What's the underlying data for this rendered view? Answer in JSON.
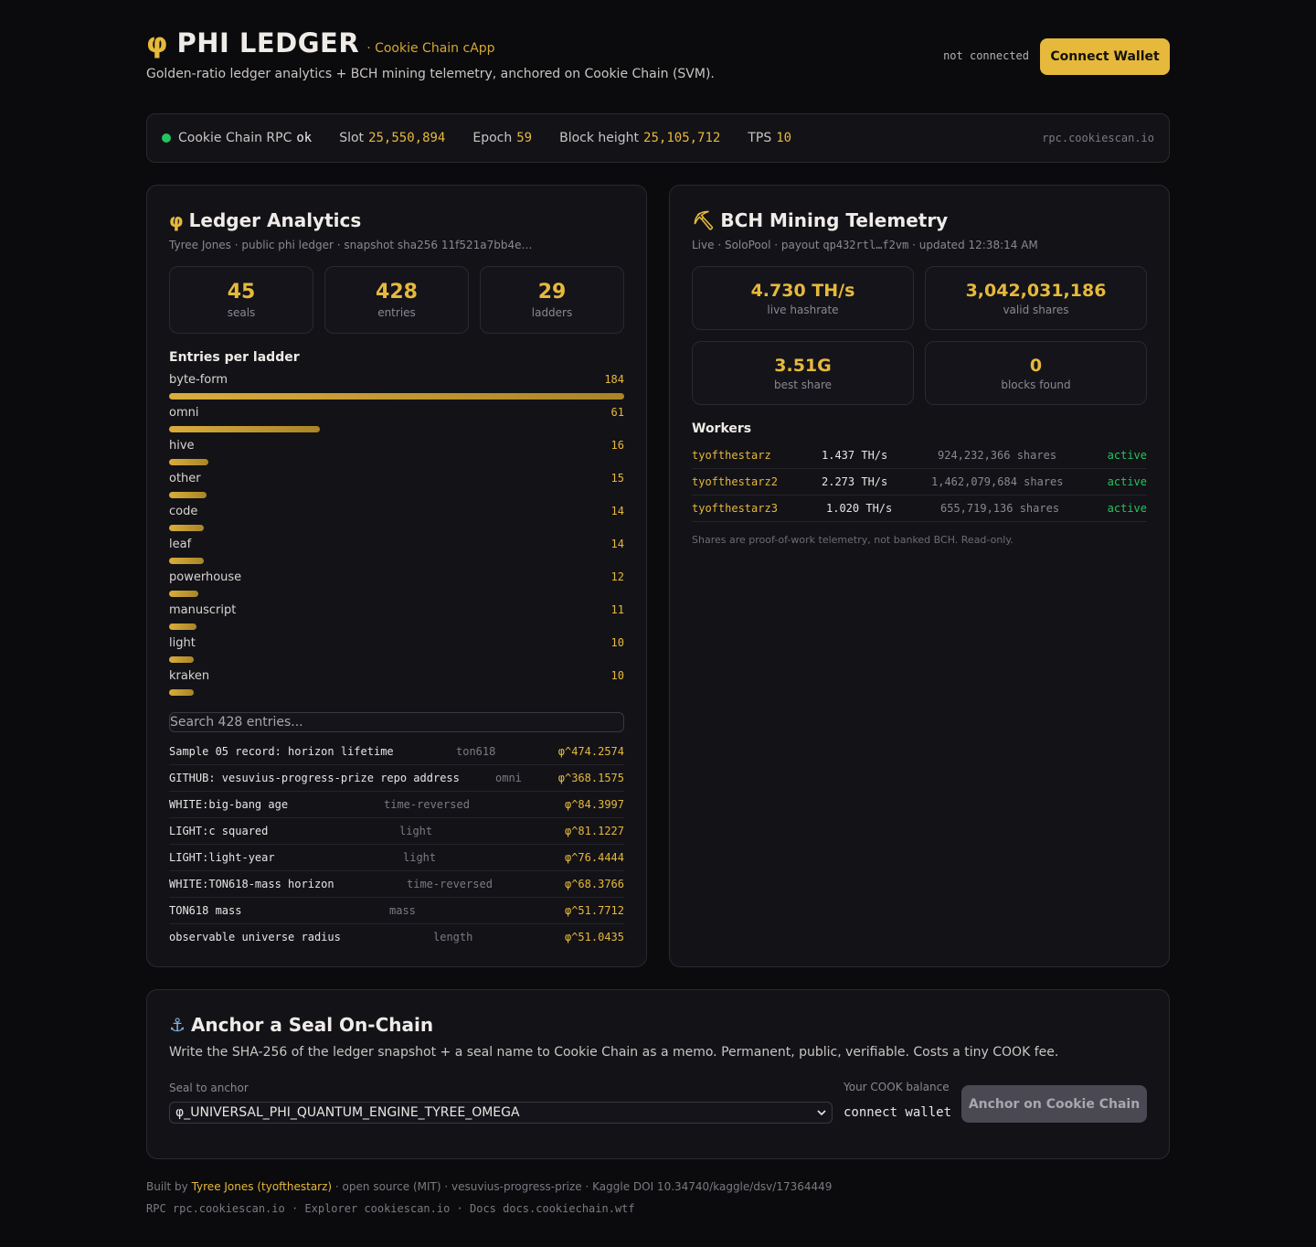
{
  "header": {
    "phi_symbol": "φ",
    "title": "PHI LEDGER",
    "subtitle": "· Cookie Chain cApp",
    "tagline": "Golden-ratio ledger analytics + BCH mining telemetry, anchored on Cookie Chain (SVM).",
    "connection_status": "not connected",
    "connect_button": "Connect Wallet"
  },
  "statusbar": {
    "rpc_label": "Cookie Chain RPC",
    "rpc_status": "ok",
    "slot_label": "Slot",
    "slot_value": "25,550,894",
    "epoch_label": "Epoch",
    "epoch_value": "59",
    "block_label": "Block height",
    "block_value": "25,105,712",
    "tps_label": "TPS",
    "tps_value": "10",
    "rpc_host": "rpc.cookiescan.io",
    "status_color": "#22c55e"
  },
  "ledger": {
    "icon": "φ",
    "title": "Ledger Analytics",
    "subtitle": "Tyree Jones · public phi ledger · snapshot sha256  11f521a7bb4e…",
    "kpis": [
      {
        "value": "45",
        "label": "seals"
      },
      {
        "value": "428",
        "label": "entries"
      },
      {
        "value": "29",
        "label": "ladders"
      }
    ],
    "ladders_heading": "Entries per ladder",
    "ladders": [
      {
        "name": "byte-form",
        "count": 184
      },
      {
        "name": "omni",
        "count": 61
      },
      {
        "name": "hive",
        "count": 16
      },
      {
        "name": "other",
        "count": 15
      },
      {
        "name": "code",
        "count": 14
      },
      {
        "name": "leaf",
        "count": 14
      },
      {
        "name": "powerhouse",
        "count": 12
      },
      {
        "name": "manuscript",
        "count": 11
      },
      {
        "name": "light",
        "count": 10
      },
      {
        "name": "kraken",
        "count": 10
      }
    ],
    "search_placeholder": "Search 428 entries...",
    "entries": [
      {
        "name": "Sample 05 record: horizon lifetime",
        "tag": "ton618",
        "phi": "φ^474.2574"
      },
      {
        "name": "GITHUB: vesuvius-progress-prize repo address",
        "tag": "omni",
        "phi": "φ^368.1575"
      },
      {
        "name": "WHITE:big-bang age",
        "tag": "time-reversed",
        "phi": "φ^84.3997"
      },
      {
        "name": "LIGHT:c squared",
        "tag": "light",
        "phi": "φ^81.1227"
      },
      {
        "name": "LIGHT:light-year",
        "tag": "light",
        "phi": "φ^76.4444"
      },
      {
        "name": "WHITE:TON618-mass horizon",
        "tag": "time-reversed",
        "phi": "φ^68.3766"
      },
      {
        "name": "TON618 mass",
        "tag": "mass",
        "phi": "φ^51.7712"
      },
      {
        "name": "observable universe radius",
        "tag": "length",
        "phi": "φ^51.0435"
      }
    ]
  },
  "mining": {
    "icon": "⛏",
    "title": "BCH Mining Telemetry",
    "sub_live": "Live · SoloPool · payout",
    "sub_payout": "qp432rtl…f2vm",
    "sub_updated": "· updated 12:38:14 AM",
    "kpis": [
      {
        "value": "4.730 TH/s",
        "label": "live hashrate"
      },
      {
        "value": "3,042,031,186",
        "label": "valid shares"
      },
      {
        "value": "3.51G",
        "label": "best share"
      },
      {
        "value": "0",
        "label": "blocks found"
      }
    ],
    "workers_heading": "Workers",
    "workers": [
      {
        "name": "tyofthestarz",
        "hashrate": "1.437 TH/s",
        "shares": "924,232,366 shares",
        "status": "active"
      },
      {
        "name": "tyofthestarz2",
        "hashrate": "2.273 TH/s",
        "shares": "1,462,079,684 shares",
        "status": "active"
      },
      {
        "name": "tyofthestarz3",
        "hashrate": "1.020 TH/s",
        "shares": "655,719,136 shares",
        "status": "active"
      }
    ],
    "note": "Shares are proof-of-work telemetry, not banked BCH. Read-only."
  },
  "anchor": {
    "icon": "⚓",
    "title": "Anchor a Seal On-Chain",
    "description": "Write the SHA-256 of the ledger snapshot + a seal name to Cookie Chain as a memo. Permanent, public, verifiable. Costs a tiny COOK fee.",
    "seal_label": "Seal to anchor",
    "seal_value": "φ_UNIVERSAL_PHI_QUANTUM_ENGINE_TYREE_OMEGA",
    "balance_label": "Your COOK balance",
    "balance_value": "connect wallet",
    "button": "Anchor on Cookie Chain"
  },
  "footer": {
    "built_by": "Built by",
    "author": "Tyree Jones (tyofthestarz)",
    "rest": "· open source (MIT) · vesuvius-progress-prize · Kaggle DOI 10.34740/kaggle/dsv/17364449",
    "line2": "RPC rpc.cookiescan.io · Explorer cookiescan.io · Docs docs.cookiechain.wtf"
  },
  "colors": {
    "accent": "#e6b93c",
    "background": "#0b0a0c",
    "card": "#131217",
    "active": "#22c55e"
  }
}
